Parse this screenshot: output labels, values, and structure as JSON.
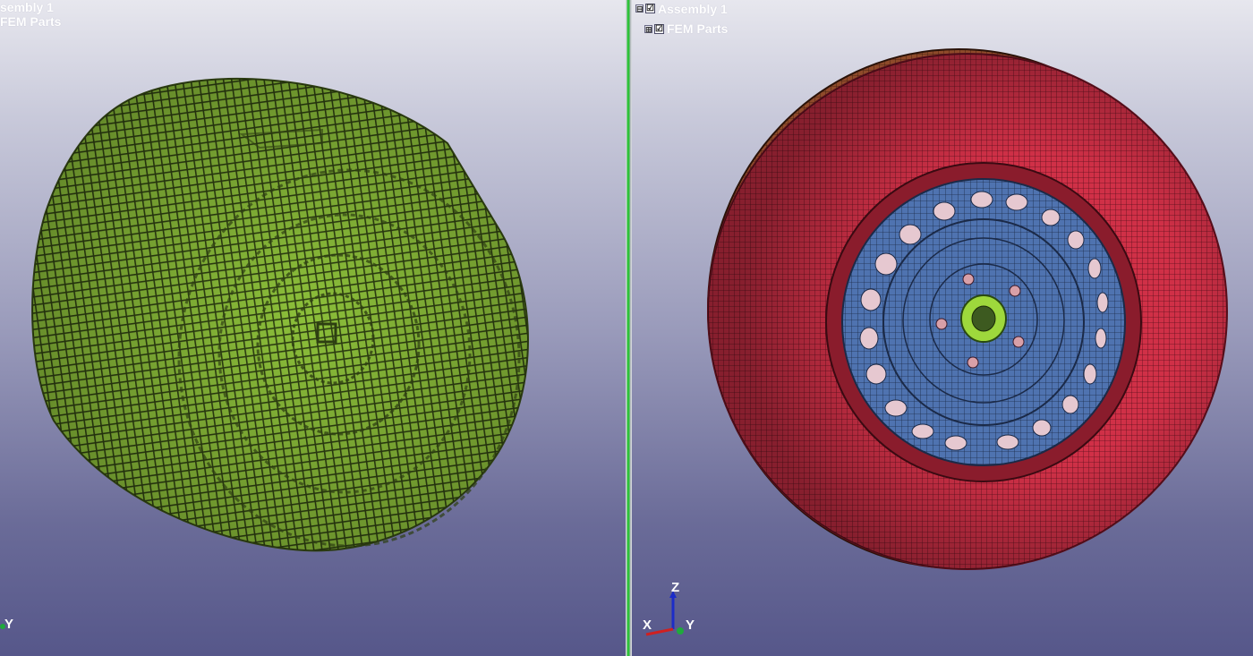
{
  "left_view": {
    "tree": {
      "root_label": "sembly 1",
      "child_label": "FEM Parts"
    },
    "triad": {
      "y_label": "Y"
    },
    "model_color": "#8cbf3a"
  },
  "right_view": {
    "tree": {
      "root_label": "Assembly 1",
      "child_label": "FEM Parts",
      "root_expander": "⊟",
      "child_expander": "⊞",
      "checkbox_state": "☑"
    },
    "triad": {
      "x_label": "X",
      "y_label": "Y",
      "z_label": "Z"
    },
    "tire_color": "#d03047",
    "rim_color": "#4f73b0",
    "hub_color": "#9ed83c"
  },
  "splitter_color": "#2ec23a"
}
